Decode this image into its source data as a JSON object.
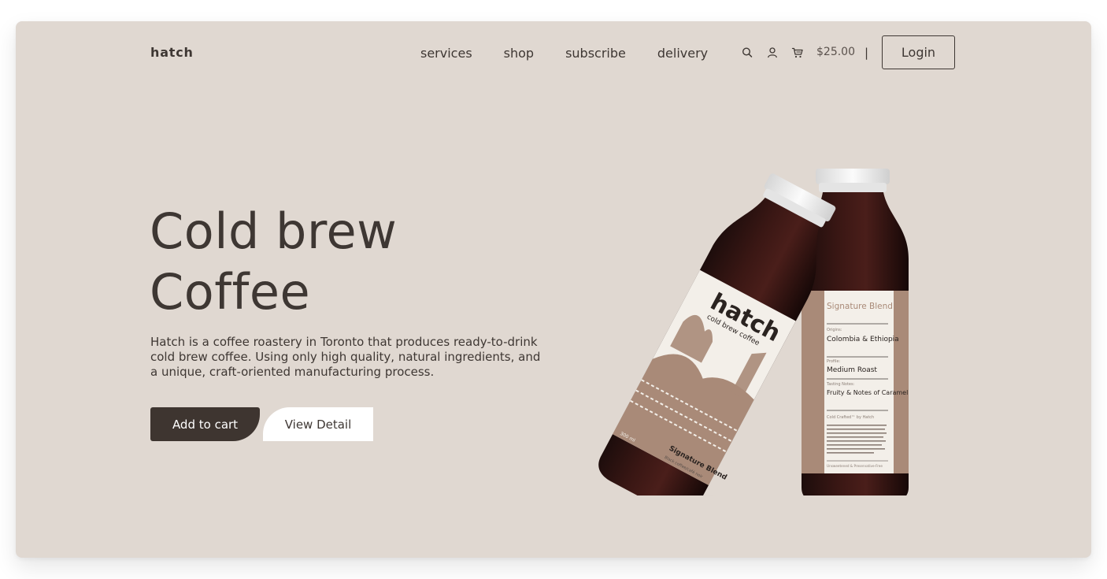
{
  "brand": "hatch",
  "nav": {
    "items": [
      "services",
      "shop",
      "subscribe",
      "delivery"
    ]
  },
  "header": {
    "cart_total": "$25.00",
    "separator": "|",
    "login_label": "Login",
    "icons": [
      "search-icon",
      "user-icon",
      "cart-icon"
    ]
  },
  "hero": {
    "title_line1": "Cold brew",
    "title_line2": "Coffee",
    "description": "Hatch is a coffee roastery in Toronto that produces ready-to-drink cold brew coffee. Using only high quality, natural ingredients, and a unique, craft-oriented manufacturing process.",
    "add_to_cart_label": "Add to cart",
    "view_detail_label": "View Detail"
  },
  "product_image": {
    "left_bottle": {
      "brand": "hatch",
      "tagline": "cold brew coffee",
      "blend": "Signature Blend",
      "note": "Black coffee/café noir",
      "volume": "300 ml"
    },
    "right_bottle": {
      "blend": "Signature Blend",
      "origins_label": "Origins:",
      "origins": "Colombia & Ethiopia",
      "profile_label": "Profile:",
      "profile": "Medium Roast",
      "notes_label": "Tasting Notes:",
      "notes": "Fruity & Notes of Caramel",
      "crafted": "Cold Crafted™ by Hatch",
      "footer": "Unsweetened & Preservative-Free"
    }
  },
  "colors": {
    "page_bg": "#ffffff",
    "card_bg": "#e0d8d1",
    "text": "#3e3733",
    "cart_button_bg": "#3e3530",
    "view_button_bg": "#ffffff",
    "label_accent": "#a98a78"
  }
}
